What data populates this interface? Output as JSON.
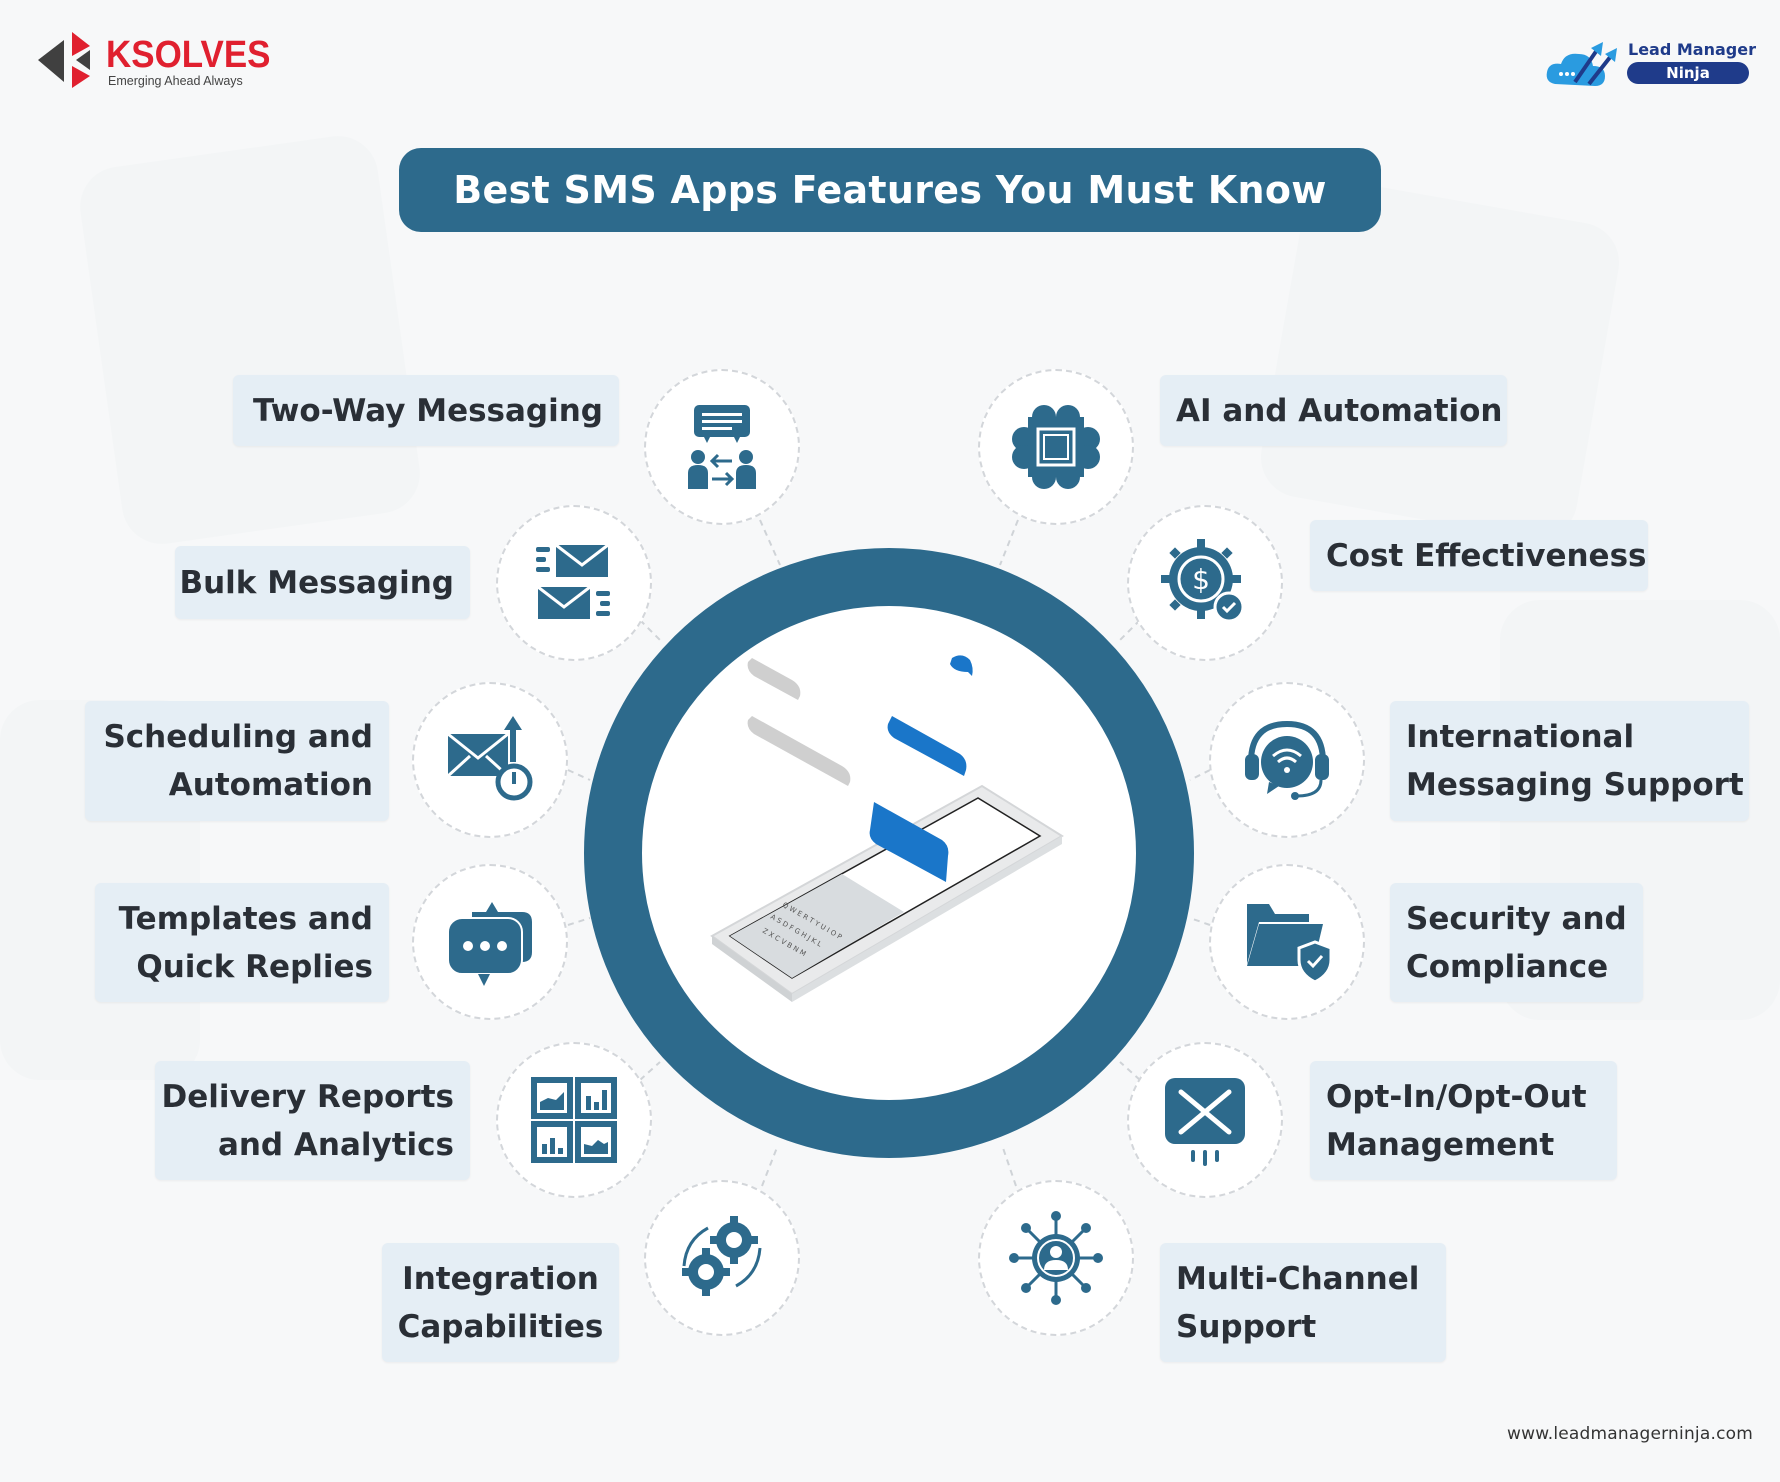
{
  "brand_left": {
    "name": "KSOLVES",
    "tagline": "Emerging Ahead Always",
    "color": "#e0202f"
  },
  "brand_right": {
    "line1": "Lead Manager",
    "line2": "Ninja",
    "color": "#1f3b8a"
  },
  "title": "Best SMS Apps Features You Must Know",
  "accent_color": "#2d6a8c",
  "label_bg": "#e5eef5",
  "features_left": [
    {
      "lines": [
        "Two-Way Messaging"
      ],
      "icon": "two-way-messaging-icon"
    },
    {
      "lines": [
        "Bulk Messaging"
      ],
      "icon": "bulk-messaging-icon"
    },
    {
      "lines": [
        "Scheduling and",
        "Automation"
      ],
      "icon": "scheduled-email-icon"
    },
    {
      "lines": [
        "Templates and",
        "Quick Replies"
      ],
      "icon": "chat-bubbles-icon"
    },
    {
      "lines": [
        "Delivery Reports",
        "and Analytics"
      ],
      "icon": "analytics-dashboard-icon"
    },
    {
      "lines": [
        "Integration",
        "Capabilities"
      ],
      "icon": "gears-sync-icon"
    }
  ],
  "features_right": [
    {
      "lines": [
        "AI and Automation"
      ],
      "icon": "ai-brain-chip-icon"
    },
    {
      "lines": [
        "Cost Effectiveness"
      ],
      "icon": "dollar-gear-check-icon"
    },
    {
      "lines": [
        "International",
        "Messaging Support"
      ],
      "icon": "headset-wifi-icon"
    },
    {
      "lines": [
        "Security and",
        "Compliance"
      ],
      "icon": "folder-shield-icon"
    },
    {
      "lines": [
        "Opt-In/Opt-Out",
        "Management"
      ],
      "icon": "unsubscribe-mail-icon"
    },
    {
      "lines": [
        "Multi-Channel",
        "Support"
      ],
      "icon": "network-user-icon"
    }
  ],
  "center_illustration": "smartphone-messaging-illustration",
  "footer_url": "www.leadmanagerninja.com"
}
